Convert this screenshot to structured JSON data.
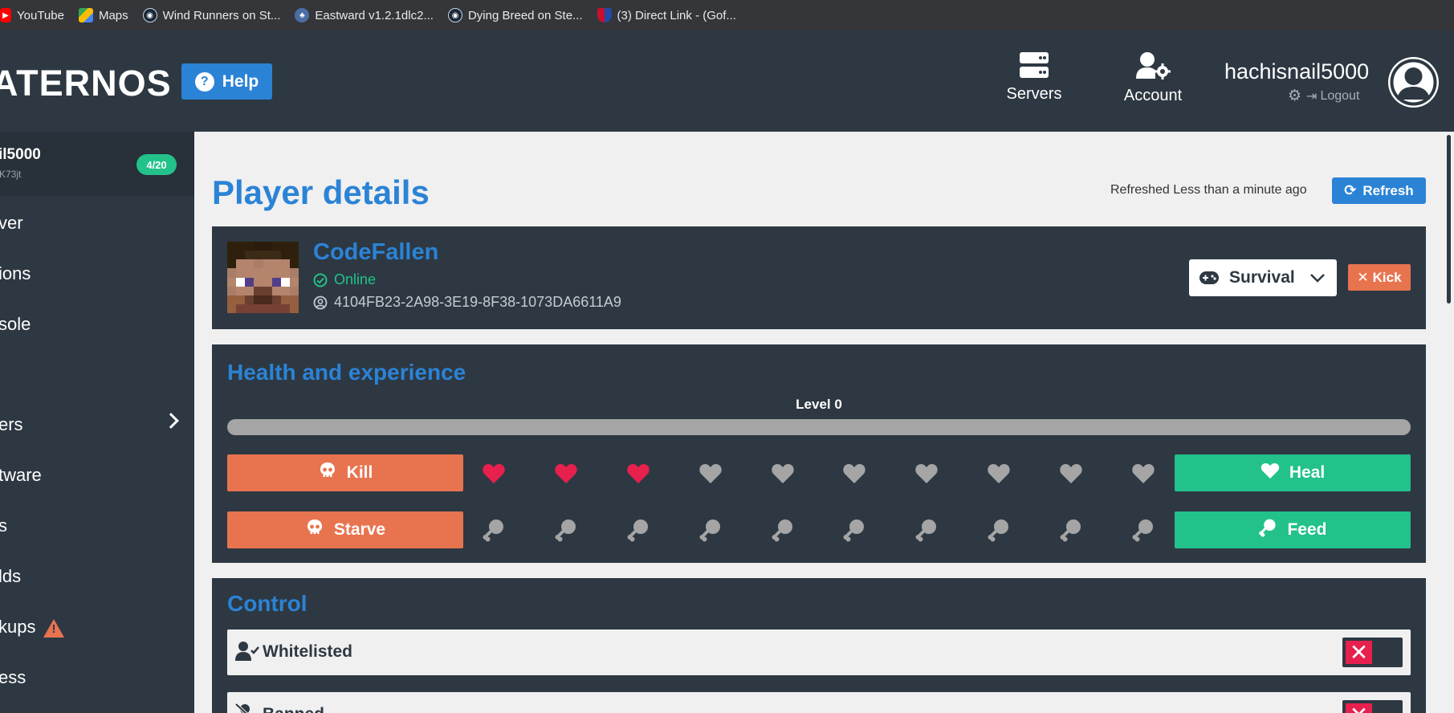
{
  "bookmarks": [
    {
      "label": "YouTube",
      "icon": "youtube-icon"
    },
    {
      "label": "Maps",
      "icon": "maps-icon"
    },
    {
      "label": "Wind Runners on St...",
      "icon": "steam-icon"
    },
    {
      "label": "Eastward v1.2.1dlc2...",
      "icon": "eastward-icon"
    },
    {
      "label": "Dying Breed on Ste...",
      "icon": "steam-icon"
    },
    {
      "label": "(3) Direct Link - (Gof...",
      "icon": "shield-icon"
    }
  ],
  "header": {
    "logo": "ATERNOS",
    "help_label": "Help",
    "nav_servers": "Servers",
    "nav_account": "Account",
    "username": "hachisnail5000",
    "logout_label": "Logout"
  },
  "sidebar": {
    "server_name": "il5000",
    "server_id": "K73jt",
    "player_badge": "4/20",
    "items": [
      "ver",
      "ions",
      "sole",
      "ers",
      "tware",
      "s",
      "lds",
      "kups",
      "ess"
    ]
  },
  "main": {
    "title": "Player details",
    "refreshed_text": "Refreshed Less than a minute ago",
    "refresh_label": "Refresh"
  },
  "player": {
    "name": "CodeFallen",
    "status": "Online",
    "uuid": "4104FB23-2A98-3E19-8F38-1073DA6611A9",
    "gamemode": "Survival",
    "kick_label": "Kick"
  },
  "health": {
    "title": "Health and experience",
    "level_label": "Level 0",
    "xp_progress": 0,
    "hearts_total": 10,
    "hearts_filled": 3,
    "food_total": 10,
    "food_filled": 0,
    "kill_label": "Kill",
    "starve_label": "Starve",
    "heal_label": "Heal",
    "feed_label": "Feed"
  },
  "control": {
    "title": "Control",
    "rows": [
      {
        "label": "Whitelisted",
        "enabled": false
      },
      {
        "label": "Banned",
        "enabled": false
      }
    ]
  },
  "colors": {
    "accent": "#2b83d6",
    "dark_panel": "#2e3842",
    "danger": "#e8744f",
    "success": "#22c28a",
    "heart_full": "#e8204d",
    "icon_empty": "#a5a5a5"
  }
}
